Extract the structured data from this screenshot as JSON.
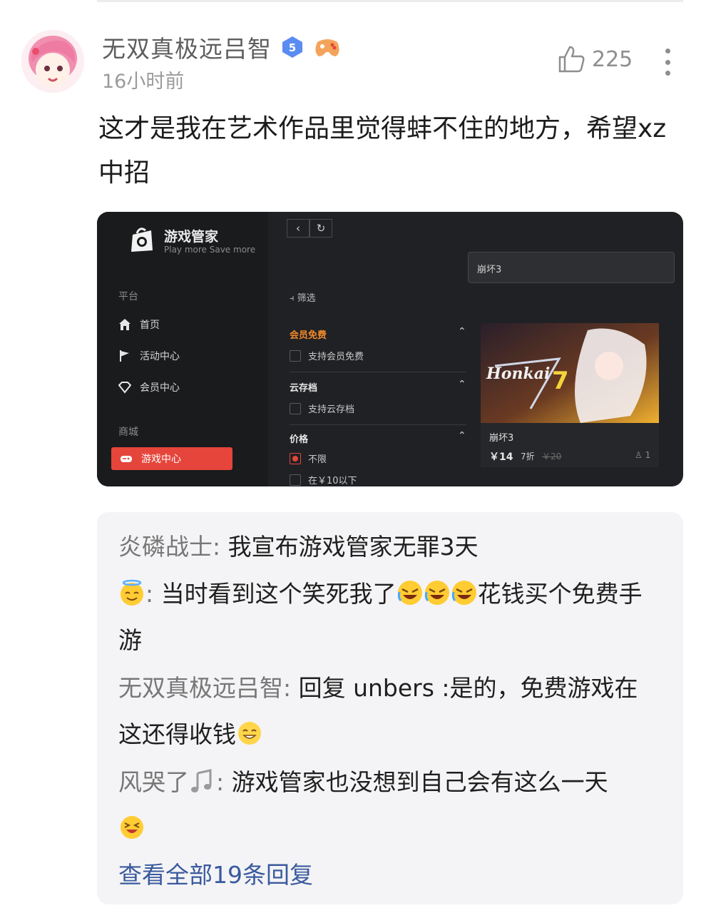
{
  "post": {
    "author": "无双真极远吕智",
    "level_badge": "5",
    "time": "16小时前",
    "likes": "225",
    "content": "这才是我在艺术作品里觉得蚌不住的地方，希望xz中招"
  },
  "screenshot": {
    "app_name": "游戏管家",
    "tagline": "Play more Save more",
    "sections": {
      "platform": "平台",
      "store": "商城"
    },
    "nav": {
      "home": "首页",
      "activity": "活动中心",
      "vip": "会员中心",
      "game_center": "游戏中心"
    },
    "search_value": "崩坏3",
    "filter_label": "筛选",
    "filters": {
      "vip_free": {
        "title": "会员免费",
        "option": "支持会员免费"
      },
      "cloud_save": {
        "title": "云存档",
        "option": "支持云存档"
      },
      "price": {
        "title": "价格",
        "option_all": "不限",
        "option_under10": "在￥10以下"
      }
    },
    "game": {
      "name": "崩坏3",
      "price": "￥14",
      "discount": "7折",
      "original_price": "￥20",
      "players": "1",
      "cover_text": "Honkai"
    },
    "colors": {
      "accent": "#e5453b",
      "vip_orange": "#f08a2a"
    }
  },
  "replies": [
    {
      "name": "炎磷战士",
      "text": "我宣布游戏管家无罪3天"
    },
    {
      "name_icon": "angel-emoji-icon",
      "text_a": "当时看到这个笑死我了",
      "emoji": "rofl-emoji-icon",
      "text_b": "花钱买个免费手游"
    },
    {
      "name": "无双真极远吕智",
      "text": "回复 unbers :是的，免费游戏在这还得收钱",
      "emoji": "grin-emoji-icon"
    },
    {
      "name": "风哭了",
      "name_icon": "music-note-icon",
      "text": "游戏管家也没想到自己会有这么一天",
      "emoji": "laughing-emoji-icon"
    }
  ],
  "view_all": "查看全部19条回复",
  "separator": ": "
}
